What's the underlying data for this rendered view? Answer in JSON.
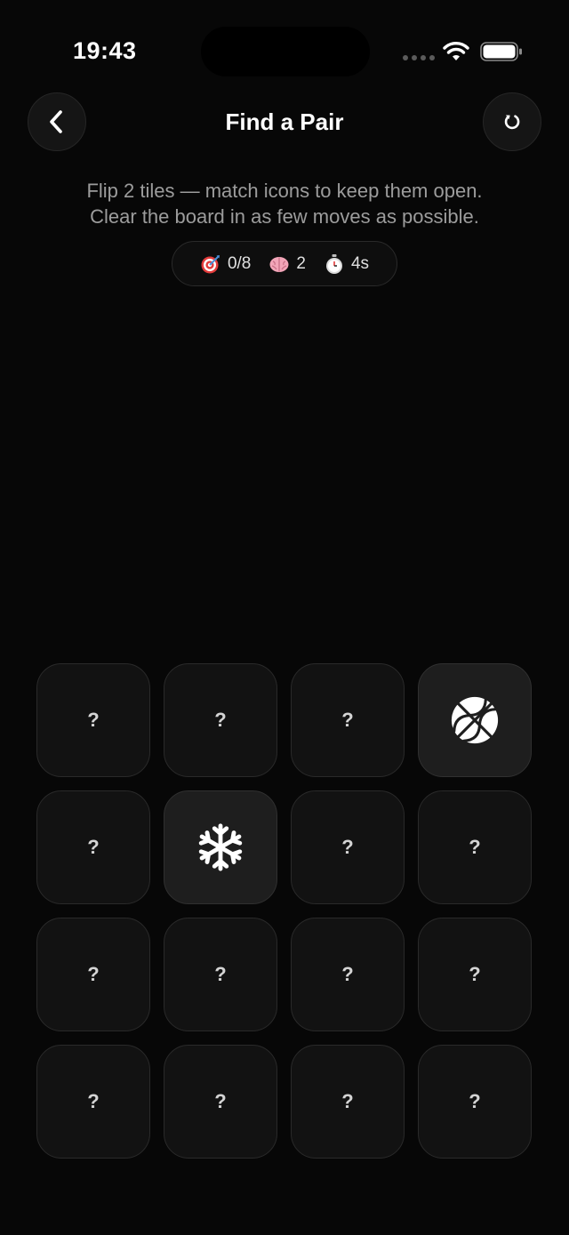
{
  "status_bar": {
    "time": "19:43"
  },
  "header": {
    "title": "Find a Pair",
    "back_icon": "chevron-left-icon",
    "restart_icon": "restart-icon"
  },
  "instructions": {
    "line1": "Flip 2 tiles — match icons to keep them open.",
    "line2": "Clear the board in as few moves as possible."
  },
  "stats": {
    "pairs": {
      "icon": "target-icon",
      "value": "0/8"
    },
    "moves": {
      "icon": "brain-icon",
      "value": "2"
    },
    "time": {
      "icon": "stopwatch-icon",
      "value": "4s"
    }
  },
  "board": {
    "rows": 4,
    "cols": 4,
    "hidden_label": "?",
    "tiles": [
      {
        "state": "hidden"
      },
      {
        "state": "hidden"
      },
      {
        "state": "hidden"
      },
      {
        "state": "open",
        "icon": "basketball-icon"
      },
      {
        "state": "hidden"
      },
      {
        "state": "open",
        "icon": "snowflake-icon"
      },
      {
        "state": "hidden"
      },
      {
        "state": "hidden"
      },
      {
        "state": "hidden"
      },
      {
        "state": "hidden"
      },
      {
        "state": "hidden"
      },
      {
        "state": "hidden"
      },
      {
        "state": "hidden"
      },
      {
        "state": "hidden"
      },
      {
        "state": "hidden"
      },
      {
        "state": "hidden"
      }
    ]
  },
  "colors": {
    "background": "#070707",
    "tile": "#121212",
    "tile_open": "#1e1e1e",
    "text_muted": "#9c9c9c"
  }
}
